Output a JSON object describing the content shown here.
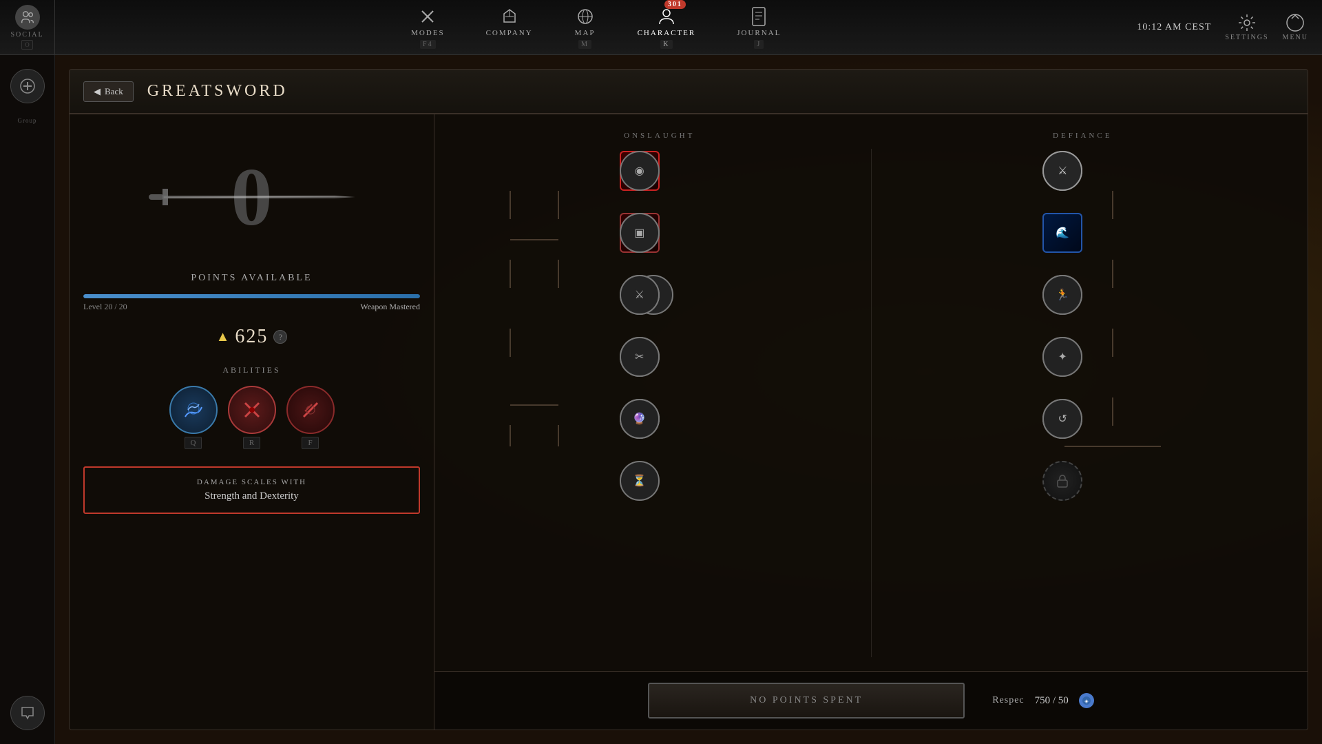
{
  "topbar": {
    "social_label": "SOCIAL",
    "social_hotkey": "O",
    "nav_items": [
      {
        "id": "modes",
        "label": "MODES",
        "hotkey": "F4",
        "icon": "✕"
      },
      {
        "id": "company",
        "label": "COMPANY",
        "hotkey": "",
        "icon": "🛡"
      },
      {
        "id": "map",
        "label": "MAP",
        "hotkey": "M",
        "icon": "🌐"
      },
      {
        "id": "character",
        "label": "CHARACTER",
        "hotkey": "K",
        "icon": "👤",
        "active": true,
        "badge": "301"
      },
      {
        "id": "journal",
        "label": "JOURNAL",
        "hotkey": "J",
        "icon": "📖"
      }
    ],
    "clock": "10:12 AM CEST",
    "settings_label": "SETTINGS",
    "menu_label": "MENU"
  },
  "panel": {
    "back_label": "Back",
    "title": "GREATSWORD",
    "points_available": "0",
    "points_label": "POINTS AVAILABLE",
    "level_current": "20",
    "level_max": "20",
    "level_label": "Level",
    "mastery_label": "Weapon Mastered",
    "xp_value": "625",
    "abilities_label": "ABILITIES",
    "ability_keys": [
      "Q",
      "R",
      "F"
    ],
    "damage_scales_title": "DAMAGE SCALES WITH",
    "damage_scales_value": "Strength and Dexterity",
    "onslaught_label": "ONSLAUGHT",
    "defiance_label": "DEFIANCE",
    "no_points_label": "NO POINTS SPENT",
    "respec_label": "Respec",
    "respec_value": "750 / 50"
  }
}
